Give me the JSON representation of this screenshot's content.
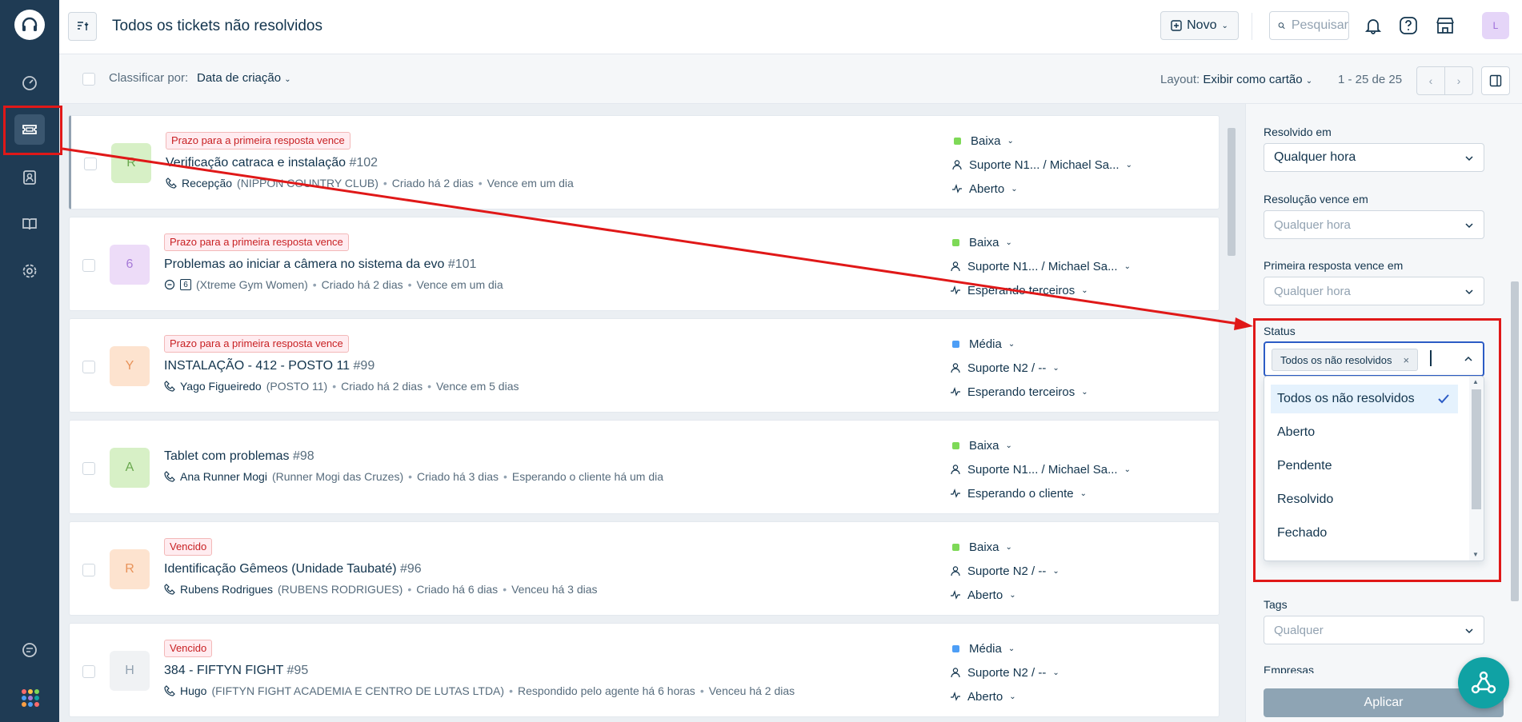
{
  "header": {
    "title": "Todos os tickets não resolvidos",
    "new_label": "Novo",
    "search_label": "Pesquisar",
    "avatar_initial": "L"
  },
  "sortbar": {
    "sort_label": "Classificar por:",
    "sort_value": "Data de criação",
    "layout_label": "Layout:",
    "layout_value": "Exibir como cartão",
    "pagination": "1 - 25 de 25"
  },
  "tickets": [
    {
      "avatar": "R",
      "avatar_bg": "#d7f0c6",
      "avatar_fg": "#6aa84f",
      "badge": "Prazo para a primeira resposta vence",
      "subject": "Verificação catraca e instalação",
      "number": "#102",
      "channel": "phone",
      "requester": "Recepção",
      "company": "(NIPPON COUNTRY CLUB)",
      "created": "Criado há 2 dias",
      "due": "Vence em um dia",
      "priority": "Baixa",
      "priority_color": "#7ed957",
      "group": "Suporte N1... / Michael Sa...",
      "status": "Aberto"
    },
    {
      "avatar": "6",
      "avatar_bg": "#eddcf8",
      "avatar_fg": "#a77bd8",
      "badge": "Prazo para a primeira resposta vence",
      "subject": "Problemas ao iniciar a câmera no sistema da evo",
      "number": "#101",
      "channel": "chat",
      "channel_tag": "6",
      "requester": "",
      "company": "(Xtreme Gym Women)",
      "created": "Criado há 2 dias",
      "due": "Vence em um dia",
      "priority": "Baixa",
      "priority_color": "#7ed957",
      "group": "Suporte N1... / Michael Sa...",
      "status": "Esperando terceiros"
    },
    {
      "avatar": "Y",
      "avatar_bg": "#fde3cf",
      "avatar_fg": "#e8935a",
      "badge": "Prazo para a primeira resposta vence",
      "subject": "INSTALAÇÃO - 412 - POSTO 11",
      "number": "#99",
      "channel": "phone",
      "requester": "Yago Figueiredo",
      "company": "(POSTO 11)",
      "created": "Criado há 2 dias",
      "due": "Vence em 5 dias",
      "priority": "Média",
      "priority_color": "#4d9ef6",
      "group": "Suporte N2 / --",
      "status": "Esperando terceiros"
    },
    {
      "avatar": "A",
      "avatar_bg": "#d7f0c6",
      "avatar_fg": "#6aa84f",
      "badge": "",
      "subject": "Tablet com problemas",
      "number": "#98",
      "channel": "phone",
      "requester": "Ana Runner Mogi",
      "company": "(Runner Mogi das Cruzes)",
      "created": "Criado há 3 dias",
      "due": "Esperando o cliente há um dia",
      "priority": "Baixa",
      "priority_color": "#7ed957",
      "group": "Suporte N1... / Michael Sa...",
      "status": "Esperando o cliente"
    },
    {
      "avatar": "R",
      "avatar_bg": "#fde3cf",
      "avatar_fg": "#e8935a",
      "badge": "Vencido",
      "subject": "Identificação Gêmeos (Unidade Taubaté)",
      "number": "#96",
      "channel": "phone",
      "requester": "Rubens Rodrigues",
      "company": "(RUBENS RODRIGUES)",
      "created": "Criado há 6 dias",
      "due": "Venceu há 3 dias",
      "priority": "Baixa",
      "priority_color": "#7ed957",
      "group": "Suporte N2 / --",
      "status": "Aberto"
    },
    {
      "avatar": "H",
      "avatar_bg": "#f0f2f4",
      "avatar_fg": "#92a2b1",
      "badge": "Vencido",
      "subject": "384 - FIFTYN FIGHT",
      "number": "#95",
      "channel": "phone",
      "requester": "Hugo",
      "company": "(FIFTYN FIGHT ACADEMIA E CENTRO DE LUTAS LTDA)",
      "created": "Respondido pelo agente há 6 horas",
      "due": "Venceu há 2 dias",
      "priority": "Média",
      "priority_color": "#4d9ef6",
      "group": "Suporte N2 / --",
      "status": "Aberto"
    }
  ],
  "filters": {
    "resolved_label": "Resolvido em",
    "resolved_value": "Qualquer hora",
    "resolution_due_label": "Resolução vence em",
    "resolution_due_placeholder": "Qualquer hora",
    "first_response_label": "Primeira resposta vence em",
    "first_response_placeholder": "Qualquer hora",
    "status_label": "Status",
    "status_chip": "Todos os não resolvidos",
    "status_options": [
      "Todos os não resolvidos",
      "Aberto",
      "Pendente",
      "Resolvido",
      "Fechado"
    ],
    "tags_label": "Tags",
    "tags_placeholder": "Qualquer",
    "companies_label": "Empresas",
    "apply_label": "Aplicar"
  }
}
